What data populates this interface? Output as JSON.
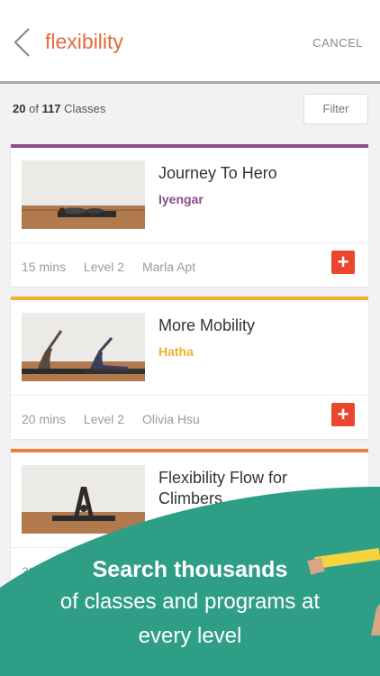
{
  "header": {
    "title": "flexibility",
    "cancel_label": "CANCEL"
  },
  "results": {
    "shown": "20",
    "of_text": "of",
    "total": "117",
    "unit": "Classes"
  },
  "filter_label": "Filter",
  "classes": [
    {
      "title": "Journey To Hero",
      "style": "Iyengar",
      "style_color": "#8b4a8c",
      "duration": "15 mins",
      "level": "Level 2",
      "teacher": "Marla Apt"
    },
    {
      "title": "More Mobility",
      "style": "Hatha",
      "style_color": "#f2b12e",
      "duration": "20 mins",
      "level": "Level 2",
      "teacher": "Olivia Hsu"
    },
    {
      "title": "Flexibility Flow for Climbers",
      "style": "",
      "style_color": "#ef7d3c",
      "duration": "30 mins",
      "level": "",
      "teacher": ""
    }
  ],
  "promo": {
    "headline": "Search thousands",
    "subline_1": "of classes and programs at",
    "subline_2": "every level"
  },
  "colors": {
    "accent": "#e5693a",
    "add_button": "#e9472d",
    "promo_green": "#2e9e86"
  },
  "icons": {
    "back": "chevron-left-icon",
    "add": "plus-icon"
  }
}
